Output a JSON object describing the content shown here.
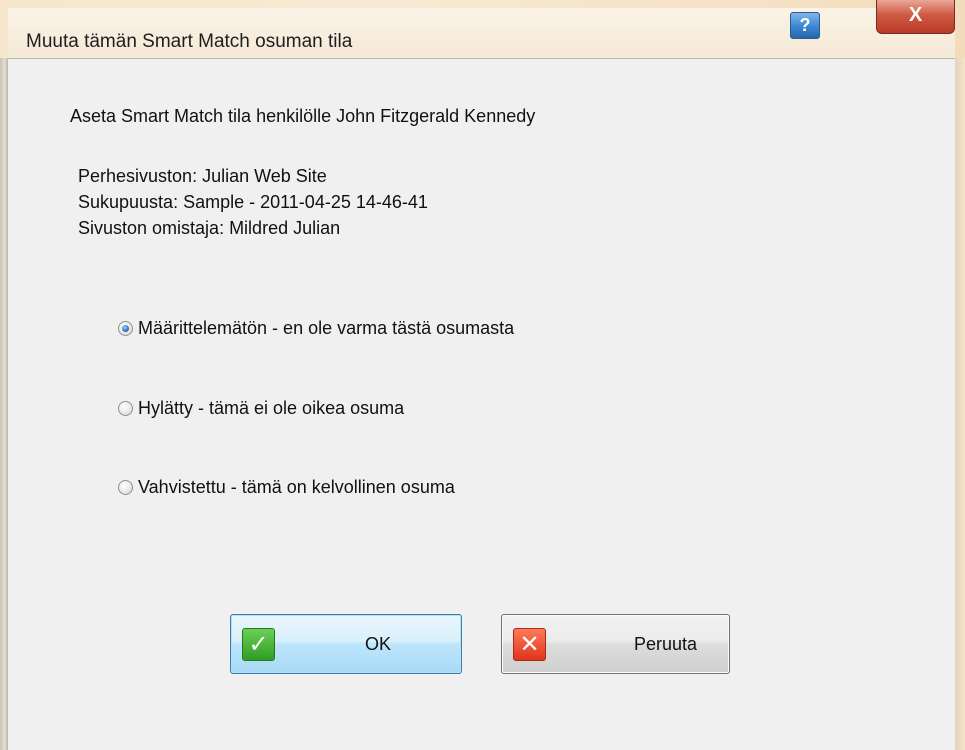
{
  "window": {
    "title": "Muuta tämän Smart Match osuman tila",
    "help_label": "?",
    "close_label": "X"
  },
  "content": {
    "heading": "Aseta Smart Match tila henkilölle John Fitzgerald Kennedy",
    "site_line": "Perhesivuston: Julian Web Site",
    "tree_line": "Sukupuusta: Sample - 2011-04-25 14-46-41",
    "owner_line": "Sivuston omistaja: Mildred Julian"
  },
  "options": [
    {
      "label": "Määrittelemätön - en ole varma tästä osumasta",
      "selected": true
    },
    {
      "label": "Hylätty - tämä ei ole oikea osuma",
      "selected": false
    },
    {
      "label": "Vahvistettu - tämä on kelvollinen osuma",
      "selected": false
    }
  ],
  "buttons": {
    "ok_label": "OK",
    "cancel_label": "Peruuta",
    "ok_icon": "checkmark-icon",
    "cancel_icon": "x-icon"
  }
}
